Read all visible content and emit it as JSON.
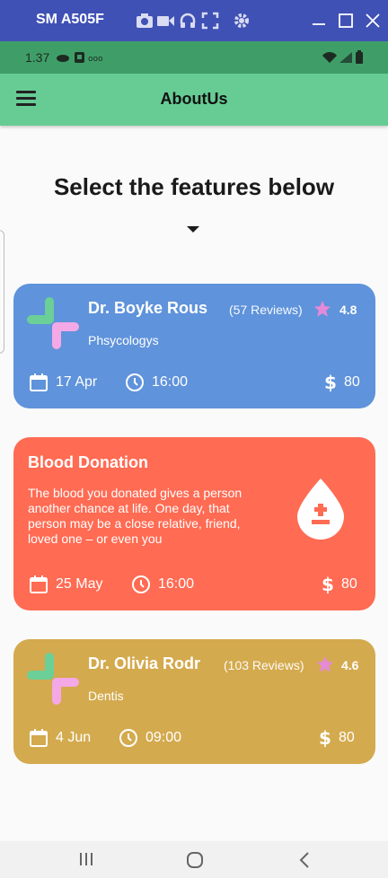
{
  "emulator": {
    "title": "SM A505F",
    "icons": [
      "camera-icon",
      "video-icon",
      "headphones-icon",
      "screenshot-icon",
      "gear-icon"
    ],
    "window_controls": [
      "minimize-icon",
      "maximize-icon",
      "close-icon"
    ]
  },
  "status_bar": {
    "time": "1.37",
    "left_icons": [
      "cloud-icon",
      "notification-icon",
      "dots-icon"
    ],
    "right_icons": [
      "wifi-icon",
      "signal-icon",
      "battery-icon"
    ]
  },
  "app_bar": {
    "title": "AboutUs",
    "menu_icon": "hamburger-menu-icon"
  },
  "main": {
    "heading": "Select the features below",
    "cards": [
      {
        "type": "doctor",
        "name": "Dr. Boyke Rous",
        "specialty": "Phsycologys",
        "reviews": "(57 Reviews)",
        "rating": "4.8",
        "date": "17 Apr",
        "time": "16:00",
        "price": "80",
        "color": "#5f93db"
      },
      {
        "type": "service",
        "title": "Blood Donation",
        "description": "The blood you donated gives a person another chance at life. One day, that person may be a close relative, friend, loved one – or even you",
        "date": "25 May",
        "time": "16:00",
        "price": "80",
        "color": "#ff6b53"
      },
      {
        "type": "doctor",
        "name": "Dr. Olivia Rodr",
        "specialty": "Dentis",
        "reviews": "(103 Reviews)",
        "rating": "4.6",
        "date": "4 Jun",
        "time": "09:00",
        "price": "80",
        "color": "#d4aa4e"
      }
    ]
  },
  "colors": {
    "emulator_bar": "#3f51b5",
    "status_bar": "#3f9e68",
    "app_bar": "#66cc94",
    "star": "#e58ad8",
    "logo_green": "#6bcf97",
    "logo_pink": "#f4a9e6"
  },
  "nav_bar": {
    "buttons": [
      "recent-apps-icon",
      "home-icon",
      "back-icon"
    ]
  }
}
